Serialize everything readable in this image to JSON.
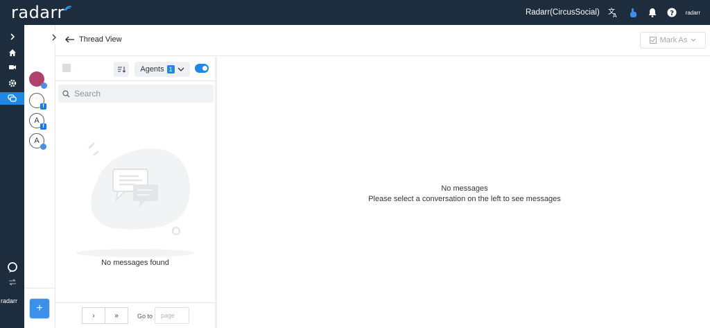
{
  "topbar": {
    "logo": "radarr",
    "account_name": "Radarr(CircusSocial)",
    "brand_small": "radarr"
  },
  "leftnav": {
    "brand": "radarr"
  },
  "accounts": {
    "items": [
      {
        "initial": "",
        "badge": ""
      },
      {
        "initial": "",
        "badge": "f"
      },
      {
        "initial": "A",
        "badge": "f"
      },
      {
        "initial": "A",
        "badge": ""
      }
    ],
    "add_label": "+"
  },
  "header": {
    "title": "Thread View",
    "mark_as": "Mark As"
  },
  "threadlist": {
    "agents_label": "Agents",
    "agents_count": "1",
    "search_placeholder": "Search",
    "empty_text": "No messages found",
    "next_label": "›",
    "last_label": "»",
    "goto_label": "Go to",
    "goto_placeholder": "page"
  },
  "message_pane": {
    "title": "No messages",
    "subtitle": "Please select a conversation on the left to see messages"
  },
  "colors": {
    "topbar_bg": "#1e2d3d",
    "accent": "#1e88e5"
  }
}
